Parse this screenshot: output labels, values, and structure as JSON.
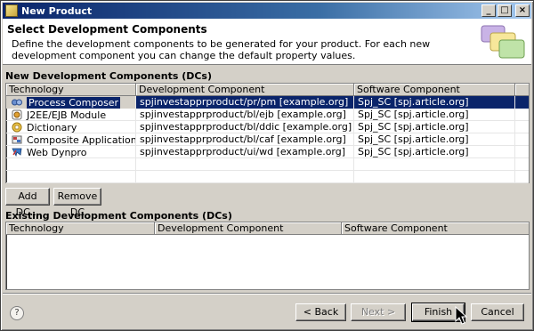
{
  "window": {
    "title": "New Product"
  },
  "header": {
    "title": "Select Development Components",
    "description": "Define the development components to be generated for your product. For each new development component you can change the default property values."
  },
  "new_dcs": {
    "label": "New Development Components (DCs)",
    "columns": [
      "Technology",
      "Development Component",
      "Software Component"
    ],
    "rows": [
      {
        "technology": "Process Composer",
        "dc": "spjinvestapprproduct/pr/pm [example.org]",
        "sc": "Spj_SC [spj.article.org]",
        "icon": "process-composer-icon",
        "selected": true
      },
      {
        "technology": "J2EE/EJB Module",
        "dc": "spjinvestapprproduct/bl/ejb [example.org]",
        "sc": "Spj_SC [spj.article.org]",
        "icon": "ejb-module-icon",
        "selected": false
      },
      {
        "technology": "Dictionary",
        "dc": "spjinvestapprproduct/bl/ddic [example.org]",
        "sc": "Spj_SC [spj.article.org]",
        "icon": "dictionary-icon",
        "selected": false
      },
      {
        "technology": "Composite Application",
        "dc": "spjinvestapprproduct/bl/caf [example.org]",
        "sc": "Spj_SC [spj.article.org]",
        "icon": "composite-application-icon",
        "selected": false
      },
      {
        "technology": "Web Dynpro",
        "dc": "spjinvestapprproduct/ui/wd [example.org]",
        "sc": "Spj_SC [spj.article.org]",
        "icon": "web-dynpro-icon",
        "selected": false
      }
    ],
    "add_button": "Add DC...",
    "remove_button": "Remove DC"
  },
  "existing_dcs": {
    "label": "Existing Development Components (DCs)",
    "columns": [
      "Technology",
      "Development Component",
      "Software Component"
    ]
  },
  "footer": {
    "help": "?",
    "back": "< Back",
    "next": "Next >",
    "finish": "Finish",
    "cancel": "Cancel"
  }
}
